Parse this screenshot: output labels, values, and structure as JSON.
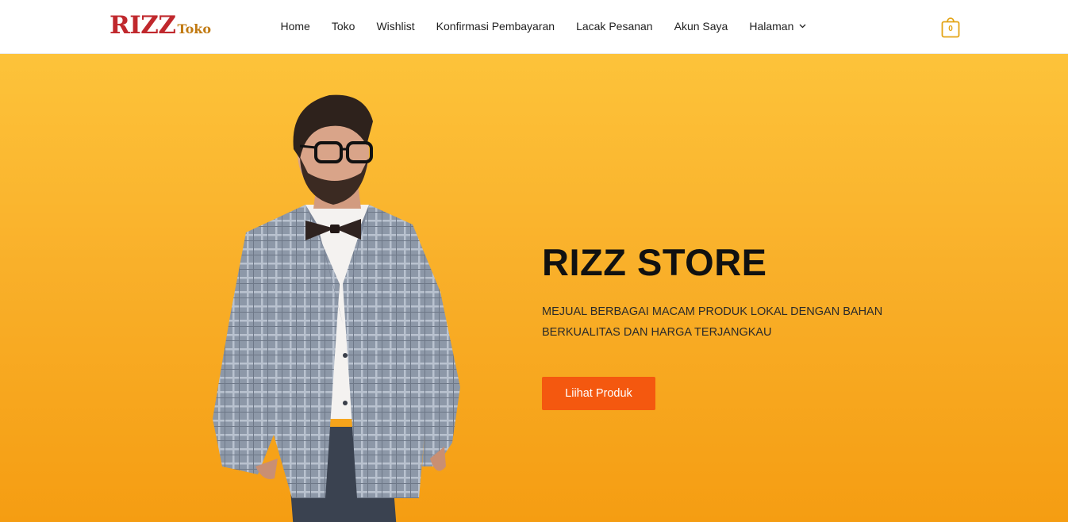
{
  "header": {
    "logo": {
      "main": "RIZZ",
      "sub": "Toko"
    },
    "nav": [
      {
        "label": "Home"
      },
      {
        "label": "Toko"
      },
      {
        "label": "Wishlist"
      },
      {
        "label": "Konfirmasi Pembayaran"
      },
      {
        "label": "Lacak Pesanan"
      },
      {
        "label": "Akun Saya"
      },
      {
        "label": "Halaman",
        "icon": "chevron-down-icon"
      }
    ],
    "cart": {
      "count": "0",
      "icon": "shopping-bag-icon"
    }
  },
  "hero": {
    "title": "RIZZ STORE",
    "description": "MEJUAL BERBAGAI MACAM PRODUK LOKAL DENGAN BAHAN BERKUALITAS DAN HARGA TERJANGKAU",
    "button_label": "Liihat Produk",
    "image": "man-in-checkered-blazer-photo"
  },
  "colors": {
    "logo_red": "#c0282d",
    "accent_orange": "#f4580f",
    "hero_yellow_top": "#fdc33a",
    "hero_yellow_bottom": "#f59d12",
    "cart_gold": "#e3a415"
  }
}
